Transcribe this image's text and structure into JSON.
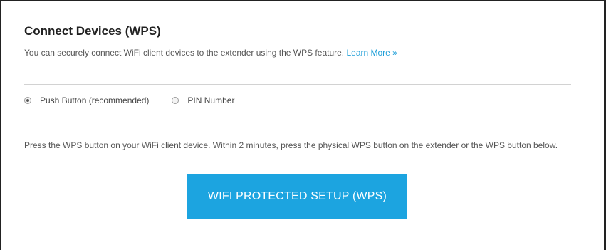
{
  "section": {
    "title": "Connect Devices (WPS)",
    "description": "You can securely connect WiFi client devices to the extender using the WPS feature.",
    "learn_more_link": "Learn More »"
  },
  "method": {
    "options": [
      {
        "label": "Push Button (recommended)",
        "selected": true
      },
      {
        "label": "PIN Number",
        "selected": false
      }
    ]
  },
  "instructions": "Press the WPS button on your WiFi client device. Within 2 minutes, press the physical WPS button on the extender or the WPS button below.",
  "wps_button_label": "WIFI PROTECTED SETUP (WPS)",
  "colors": {
    "accent": "#1ca4e0",
    "link": "#1f9fd8"
  }
}
